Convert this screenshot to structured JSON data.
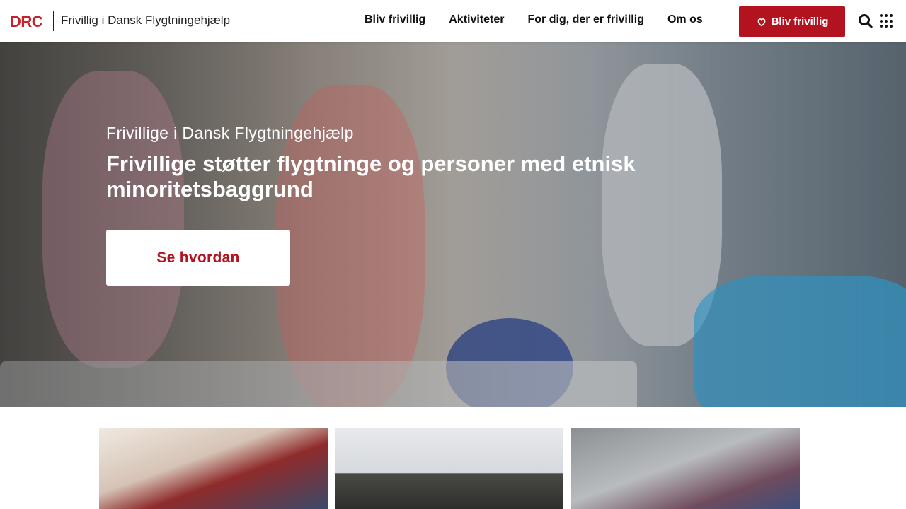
{
  "header": {
    "logo_text": "DRC",
    "site_title": "Frivillig i Dansk Flygtningehjælp",
    "nav": [
      "Bliv frivillig",
      "Aktiviteter",
      "For dig, der er frivillig",
      "Om os"
    ],
    "cta_label": "Bliv frivillig",
    "cta_icon": "heart-icon",
    "search_icon": "search-icon",
    "menu_icon": "apps-grid-icon",
    "accent_color": "#b3121f"
  },
  "hero": {
    "kicker": "Frivillige i Dansk Flygtningehjælp",
    "title": "Frivillige støtter flygtninge og personer med etnisk minoritetsbaggrund",
    "button_label": "Se hvordan"
  },
  "cards": [
    {
      "image": "children-studying-photo"
    },
    {
      "image": "two-men-selfie-photo"
    },
    {
      "image": "woman-in-kitchen-photo"
    }
  ]
}
